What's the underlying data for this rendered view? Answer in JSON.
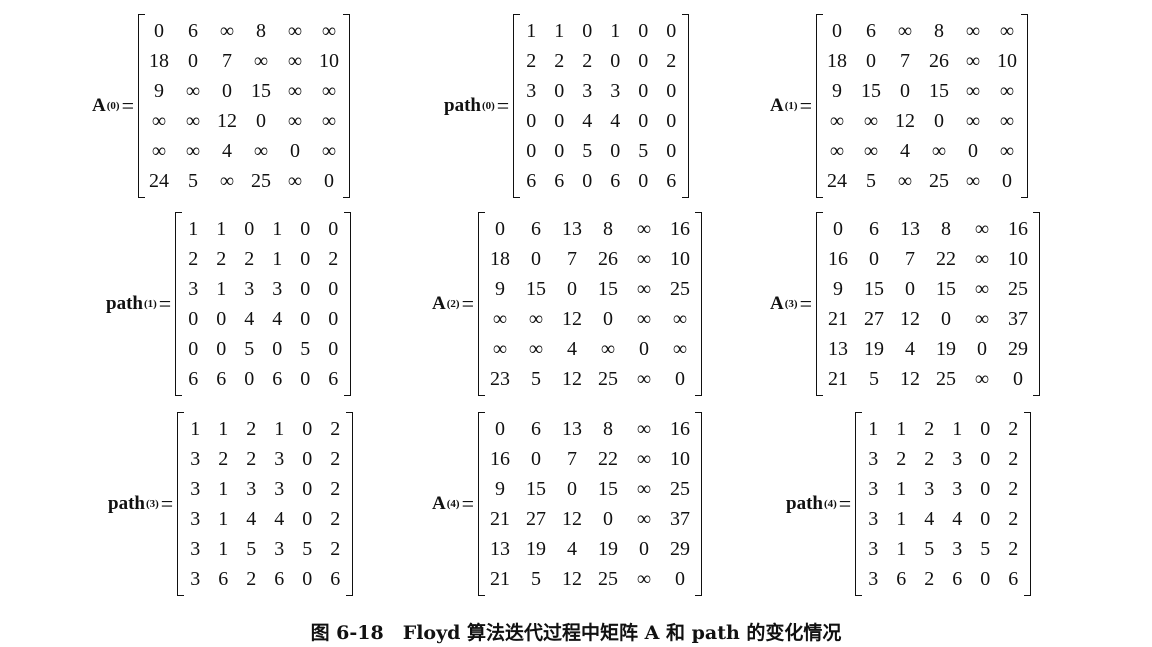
{
  "matrices": [
    {
      "base": "A",
      "sup": "(0)",
      "rows": [
        [
          "0",
          "6",
          "∞",
          "8",
          "∞",
          "∞"
        ],
        [
          "18",
          "0",
          "7",
          "∞",
          "∞",
          "10"
        ],
        [
          "9",
          "∞",
          "0",
          "15",
          "∞",
          "∞"
        ],
        [
          "∞",
          "∞",
          "12",
          "0",
          "∞",
          "∞"
        ],
        [
          "∞",
          "∞",
          "4",
          "∞",
          "0",
          "∞"
        ],
        [
          "24",
          "5",
          "∞",
          "25",
          "∞",
          "0"
        ]
      ]
    },
    {
      "base": "path",
      "sup": "(0)",
      "rows": [
        [
          "1",
          "1",
          "0",
          "1",
          "0",
          "0"
        ],
        [
          "2",
          "2",
          "2",
          "0",
          "0",
          "2"
        ],
        [
          "3",
          "0",
          "3",
          "3",
          "0",
          "0"
        ],
        [
          "0",
          "0",
          "4",
          "4",
          "0",
          "0"
        ],
        [
          "0",
          "0",
          "5",
          "0",
          "5",
          "0"
        ],
        [
          "6",
          "6",
          "0",
          "6",
          "0",
          "6"
        ]
      ]
    },
    {
      "base": "A",
      "sup": "(1)",
      "rows": [
        [
          "0",
          "6",
          "∞",
          "8",
          "∞",
          "∞"
        ],
        [
          "18",
          "0",
          "7",
          "26",
          "∞",
          "10"
        ],
        [
          "9",
          "15",
          "0",
          "15",
          "∞",
          "∞"
        ],
        [
          "∞",
          "∞",
          "12",
          "0",
          "∞",
          "∞"
        ],
        [
          "∞",
          "∞",
          "4",
          "∞",
          "0",
          "∞"
        ],
        [
          "24",
          "5",
          "∞",
          "25",
          "∞",
          "0"
        ]
      ]
    },
    {
      "base": "path",
      "sup": "(1)",
      "rows": [
        [
          "1",
          "1",
          "0",
          "1",
          "0",
          "0"
        ],
        [
          "2",
          "2",
          "2",
          "1",
          "0",
          "2"
        ],
        [
          "3",
          "1",
          "3",
          "3",
          "0",
          "0"
        ],
        [
          "0",
          "0",
          "4",
          "4",
          "0",
          "0"
        ],
        [
          "0",
          "0",
          "5",
          "0",
          "5",
          "0"
        ],
        [
          "6",
          "6",
          "0",
          "6",
          "0",
          "6"
        ]
      ]
    },
    {
      "base": "A",
      "sup": "(2)",
      "rows": [
        [
          "0",
          "6",
          "13",
          "8",
          "∞",
          "16"
        ],
        [
          "18",
          "0",
          "7",
          "26",
          "∞",
          "10"
        ],
        [
          "9",
          "15",
          "0",
          "15",
          "∞",
          "25"
        ],
        [
          "∞",
          "∞",
          "12",
          "0",
          "∞",
          "∞"
        ],
        [
          "∞",
          "∞",
          "4",
          "∞",
          "0",
          "∞"
        ],
        [
          "23",
          "5",
          "12",
          "25",
          "∞",
          "0"
        ]
      ]
    },
    {
      "base": "A",
      "sup": "(3)",
      "rows": [
        [
          "0",
          "6",
          "13",
          "8",
          "∞",
          "16"
        ],
        [
          "16",
          "0",
          "7",
          "22",
          "∞",
          "10"
        ],
        [
          "9",
          "15",
          "0",
          "15",
          "∞",
          "25"
        ],
        [
          "21",
          "27",
          "12",
          "0",
          "∞",
          "37"
        ],
        [
          "13",
          "19",
          "4",
          "19",
          "0",
          "29"
        ],
        [
          "21",
          "5",
          "12",
          "25",
          "∞",
          "0"
        ]
      ]
    },
    {
      "base": "path",
      "sup": "(3)",
      "rows": [
        [
          "1",
          "1",
          "2",
          "1",
          "0",
          "2"
        ],
        [
          "3",
          "2",
          "2",
          "3",
          "0",
          "2"
        ],
        [
          "3",
          "1",
          "3",
          "3",
          "0",
          "2"
        ],
        [
          "3",
          "1",
          "4",
          "4",
          "0",
          "2"
        ],
        [
          "3",
          "1",
          "5",
          "3",
          "5",
          "2"
        ],
        [
          "3",
          "6",
          "2",
          "6",
          "0",
          "6"
        ]
      ]
    },
    {
      "base": "A",
      "sup": "(4)",
      "rows": [
        [
          "0",
          "6",
          "13",
          "8",
          "∞",
          "16"
        ],
        [
          "16",
          "0",
          "7",
          "22",
          "∞",
          "10"
        ],
        [
          "9",
          "15",
          "0",
          "15",
          "∞",
          "25"
        ],
        [
          "21",
          "27",
          "12",
          "0",
          "∞",
          "37"
        ],
        [
          "13",
          "19",
          "4",
          "19",
          "0",
          "29"
        ],
        [
          "21",
          "5",
          "12",
          "25",
          "∞",
          "0"
        ]
      ]
    },
    {
      "base": "path",
      "sup": "(4)",
      "rows": [
        [
          "1",
          "1",
          "2",
          "1",
          "0",
          "2"
        ],
        [
          "3",
          "2",
          "2",
          "3",
          "0",
          "2"
        ],
        [
          "3",
          "1",
          "3",
          "3",
          "0",
          "2"
        ],
        [
          "3",
          "1",
          "4",
          "4",
          "0",
          "2"
        ],
        [
          "3",
          "1",
          "5",
          "3",
          "5",
          "2"
        ],
        [
          "3",
          "6",
          "2",
          "6",
          "0",
          "6"
        ]
      ]
    }
  ],
  "equals_sign": "=",
  "caption": "图 6-18　Floyd 算法迭代过程中矩阵 A 和 path 的变化情况"
}
